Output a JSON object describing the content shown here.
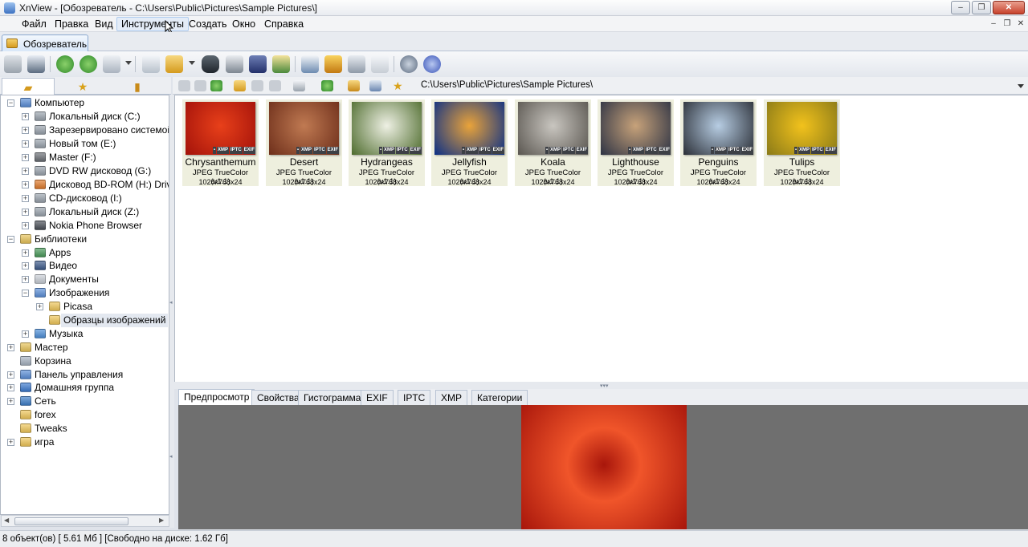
{
  "window": {
    "title": "XnView - [Обозреватель - C:\\Users\\Public\\Pictures\\Sample Pictures\\]",
    "buttons": {
      "minimize": "–",
      "maximize": "❐",
      "close": "✕"
    }
  },
  "menu": {
    "items": [
      "Файл",
      "Правка",
      "Вид",
      "Инструменты",
      "Создать",
      "Окно",
      "Справка"
    ],
    "hover_item": "Инструменты",
    "mdi_buttons": [
      "–",
      "❐",
      "✕"
    ]
  },
  "doc_tab": {
    "label": "Обозреватель"
  },
  "left_tabs": {
    "folders_icon": "folder-icon",
    "favorites_icon": "star-icon",
    "categories_icon": "book-icon"
  },
  "tree": [
    {
      "label": "Компьютер",
      "level": 0,
      "expander": "−",
      "icon": "computer-icon",
      "color": "#5b8fd8"
    },
    {
      "label": "Локальный диск (C:)",
      "level": 1,
      "expander": "+",
      "icon": "disk-icon",
      "color": "#9aa3ad"
    },
    {
      "label": "Зарезервировано системой",
      "level": 1,
      "expander": "+",
      "icon": "disk-icon",
      "color": "#9aa3ad"
    },
    {
      "label": "Новый том (E:)",
      "level": 1,
      "expander": "+",
      "icon": "disk-icon",
      "color": "#9aa3ad"
    },
    {
      "label": "Master (F:)",
      "level": 1,
      "expander": "+",
      "icon": "disk-icon",
      "color": "#6b6f75"
    },
    {
      "label": "DVD RW дисковод (G:)",
      "level": 1,
      "expander": "+",
      "icon": "dvd-icon",
      "color": "#9aa3ad"
    },
    {
      "label": "Дисковод BD-ROM (H:) Drive",
      "level": 1,
      "expander": "+",
      "icon": "bd-icon",
      "color": "#e07b2c"
    },
    {
      "label": "CD-дисковод (I:)",
      "level": 1,
      "expander": "+",
      "icon": "cd-icon",
      "color": "#9aa3ad"
    },
    {
      "label": "Локальный диск (Z:)",
      "level": 1,
      "expander": "+",
      "icon": "disk-icon",
      "color": "#9aa3ad"
    },
    {
      "label": "Nokia Phone Browser",
      "level": 1,
      "expander": "+",
      "icon": "phone-icon",
      "color": "#4a4f57"
    },
    {
      "label": "Библиотеки",
      "level": 0,
      "expander": "−",
      "icon": "library-icon",
      "color": "#e8c45a"
    },
    {
      "label": "Apps",
      "level": 1,
      "expander": "+",
      "icon": "apps-icon",
      "color": "#4a9a5a"
    },
    {
      "label": "Видео",
      "level": 1,
      "expander": "+",
      "icon": "video-icon",
      "color": "#3d5a8a"
    },
    {
      "label": "Документы",
      "level": 1,
      "expander": "+",
      "icon": "documents-icon",
      "color": "#c9ced6"
    },
    {
      "label": "Изображения",
      "level": 1,
      "expander": "−",
      "icon": "pictures-icon",
      "color": "#5b8fd8"
    },
    {
      "label": "Picasa",
      "level": 2,
      "expander": "+",
      "icon": "folder-icon",
      "color": "#f0c75a"
    },
    {
      "label": "Образцы изображений",
      "level": 2,
      "expander": "",
      "icon": "folder-icon",
      "color": "#f0c75a",
      "selected": true
    },
    {
      "label": "Музыка",
      "level": 1,
      "expander": "+",
      "icon": "music-icon",
      "color": "#4d8fd8"
    },
    {
      "label": "Мастер",
      "level": 0,
      "expander": "+",
      "icon": "user-folder-icon",
      "color": "#e8c45a"
    },
    {
      "label": "Корзина",
      "level": 0,
      "expander": "",
      "icon": "recycle-bin-icon",
      "color": "#a9b4c2"
    },
    {
      "label": "Панель управления",
      "level": 0,
      "expander": "+",
      "icon": "control-panel-icon",
      "color": "#5b8fd8"
    },
    {
      "label": "Домашняя группа",
      "level": 0,
      "expander": "+",
      "icon": "homegroup-icon",
      "color": "#3d7bd0"
    },
    {
      "label": "Сеть",
      "level": 0,
      "expander": "+",
      "icon": "network-icon",
      "color": "#3f7fc9"
    },
    {
      "label": "forex",
      "level": 0,
      "expander": "",
      "icon": "folder-icon",
      "color": "#f0c75a"
    },
    {
      "label": "Tweaks",
      "level": 0,
      "expander": "",
      "icon": "folder-icon",
      "color": "#f0c75a"
    },
    {
      "label": "игра",
      "level": 0,
      "expander": "+",
      "icon": "folder-icon",
      "color": "#f0c75a"
    }
  ],
  "nav": {
    "path": "C:\\Users\\Public\\Pictures\\Sample Pictures\\"
  },
  "thumbnails": [
    {
      "name": "Chrysanthemum",
      "format": "JPEG TrueColor (v1.1)",
      "dims": "1024x768x24",
      "colors": [
        "#e8401a",
        "#a3120a"
      ]
    },
    {
      "name": "Desert",
      "format": "JPEG TrueColor (v1.1)",
      "dims": "1024x768x24",
      "colors": [
        "#c07a52",
        "#6d2e1a"
      ]
    },
    {
      "name": "Hydrangeas",
      "format": "JPEG TrueColor (v1.1)",
      "dims": "1024x768x24",
      "colors": [
        "#eef0e4",
        "#4d6b2c"
      ]
    },
    {
      "name": "Jellyfish",
      "format": "JPEG TrueColor (v1.1)",
      "dims": "1024x768x24",
      "colors": [
        "#e9a33a",
        "#0b2f86"
      ]
    },
    {
      "name": "Koala",
      "format": "JPEG TrueColor (v1.1)",
      "dims": "1024x768x24",
      "colors": [
        "#c9c6c0",
        "#5a5650"
      ]
    },
    {
      "name": "Lighthouse",
      "format": "JPEG TrueColor (v1.1)",
      "dims": "1024x768x24",
      "colors": [
        "#c7a27a",
        "#2d3344"
      ]
    },
    {
      "name": "Penguins",
      "format": "JPEG TrueColor (v1.1)",
      "dims": "1024x768x24",
      "colors": [
        "#b7cde3",
        "#2a2e36"
      ]
    },
    {
      "name": "Tulips",
      "format": "JPEG TrueColor (v1.1)",
      "dims": "1024x768x24",
      "colors": [
        "#f2c21c",
        "#8a7a18"
      ]
    }
  ],
  "thumb_badges": [
    "▪",
    "XMP",
    "IPTC",
    "EXIF"
  ],
  "preview_tabs": [
    "Предпросмотр",
    "Свойства",
    "Гистограмма",
    "EXIF",
    "IPTC",
    "XMP",
    "Категории"
  ],
  "preview": {
    "colors": [
      "#f0552a",
      "#a8160b"
    ]
  },
  "status": {
    "text": "8 объект(ов) [ 5.61 Мб ] [Свободно на диске: 1.62 Гб]"
  }
}
